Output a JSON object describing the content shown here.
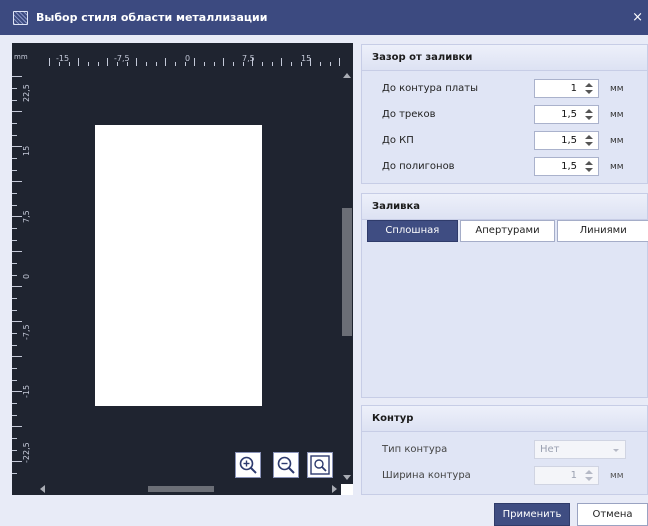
{
  "window": {
    "title": "Выбор стиля области металлизации",
    "close_glyph": "×",
    "title_icon": "hatched-area-icon"
  },
  "preview": {
    "unit_label": "mm",
    "top_ruler_labels": [
      "-15",
      "-7,5",
      "0",
      "7,5",
      "15"
    ],
    "left_ruler_labels": [
      "22,5",
      "15",
      "7,5",
      "0",
      "-7,5",
      "-15",
      "-22,5"
    ],
    "zoom_buttons": [
      "zoom-in-icon",
      "zoom-out-icon",
      "zoom-fit-icon"
    ]
  },
  "clearance": {
    "title": "Зазор от заливки",
    "rows": [
      {
        "label": "До контура платы",
        "value": "1",
        "unit": "мм"
      },
      {
        "label": "До треков",
        "value": "1,5",
        "unit": "мм"
      },
      {
        "label": "До КП",
        "value": "1,5",
        "unit": "мм"
      },
      {
        "label": "До полигонов",
        "value": "1,5",
        "unit": "мм"
      }
    ]
  },
  "fill": {
    "title": "Заливка",
    "tabs": [
      "Сплошная",
      "Апертурами",
      "Линиями"
    ],
    "active_tab": "Сплошная"
  },
  "contour": {
    "title": "Контур",
    "type_label": "Тип контура",
    "type_value": "Нет",
    "width_label": "Ширина контура",
    "width_value": "1",
    "width_unit": "мм"
  },
  "buttons": {
    "apply": "Применить",
    "cancel": "Отмена"
  },
  "colors": {
    "titlebar": "#3c4a80",
    "canvas": "#1f2430",
    "accent": "#3f4d82",
    "panel": "#e0e5f5"
  }
}
